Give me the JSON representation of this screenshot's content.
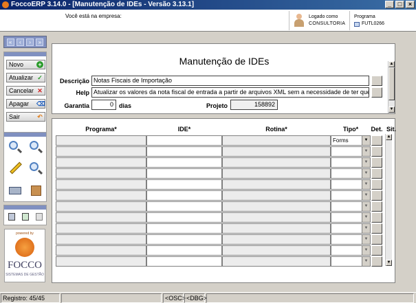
{
  "window": {
    "title": "FoccoERP 3.14.0 - [Manutenção de IDEs - Versão 3.13.1]",
    "minimize_icon": "minimize-icon",
    "maximize_icon": "maximize-icon",
    "close_icon": "close-icon"
  },
  "header": {
    "empresa_label": "Você está na empresa:",
    "user_label": "Logado como",
    "user_name": "CONSULTORIA",
    "programa_label": "Programa",
    "programa_code": "FUTL0266"
  },
  "nav": {
    "buttons": [
      "«",
      "‹",
      "›",
      "»"
    ]
  },
  "actions": [
    {
      "label": "Novo",
      "icon": "plus-icon",
      "color": "#2a9a2a",
      "glyph": "+"
    },
    {
      "label": "Atualizar",
      "icon": "check-icon",
      "color": "#2a9a2a",
      "glyph": "✓"
    },
    {
      "label": "Cancelar",
      "icon": "cancel-icon",
      "color": "#d02020",
      "glyph": "✕"
    },
    {
      "label": "Apagar",
      "icon": "eraser-icon",
      "color": "#2060c0",
      "glyph": "⌫"
    },
    {
      "label": "Sair",
      "icon": "exit-icon",
      "color": "#e08020",
      "glyph": "↶"
    }
  ],
  "tools": [
    "search-icon",
    "search-all-icon",
    "edit-icon",
    "zoom-icon",
    "print-icon",
    "package-icon"
  ],
  "small_tools": [
    "calculator-icon",
    "export-icon",
    "cursor-icon"
  ],
  "logo": {
    "powered": "powered by",
    "brand": "FOCCO",
    "tagline": "SISTEMAS DE GESTÃO"
  },
  "form": {
    "title": "Manutenção de IDEs",
    "descricao_label": "Descrição",
    "descricao_value": "Notas Fiscais de Importação",
    "help_label": "Help",
    "help_value": "Atualizar os valores da nota fiscal de entrada a partir de arquivos XML sem a necessidade de ter que alterar manu",
    "garantia_label": "Garantia",
    "garantia_value": "0",
    "garantia_unit": "dias",
    "projeto_label": "Projeto",
    "projeto_value": "158892"
  },
  "grid": {
    "columns": [
      "Programa*",
      "IDE*",
      "Rotina*",
      "Tipo*",
      "Det.",
      "Sit."
    ],
    "first_row_tipo": "Forms",
    "row_count": 12
  },
  "status": {
    "registro": "Registro: 45/45",
    "osc": "<OSC>",
    "dbg": "<DBG>"
  }
}
